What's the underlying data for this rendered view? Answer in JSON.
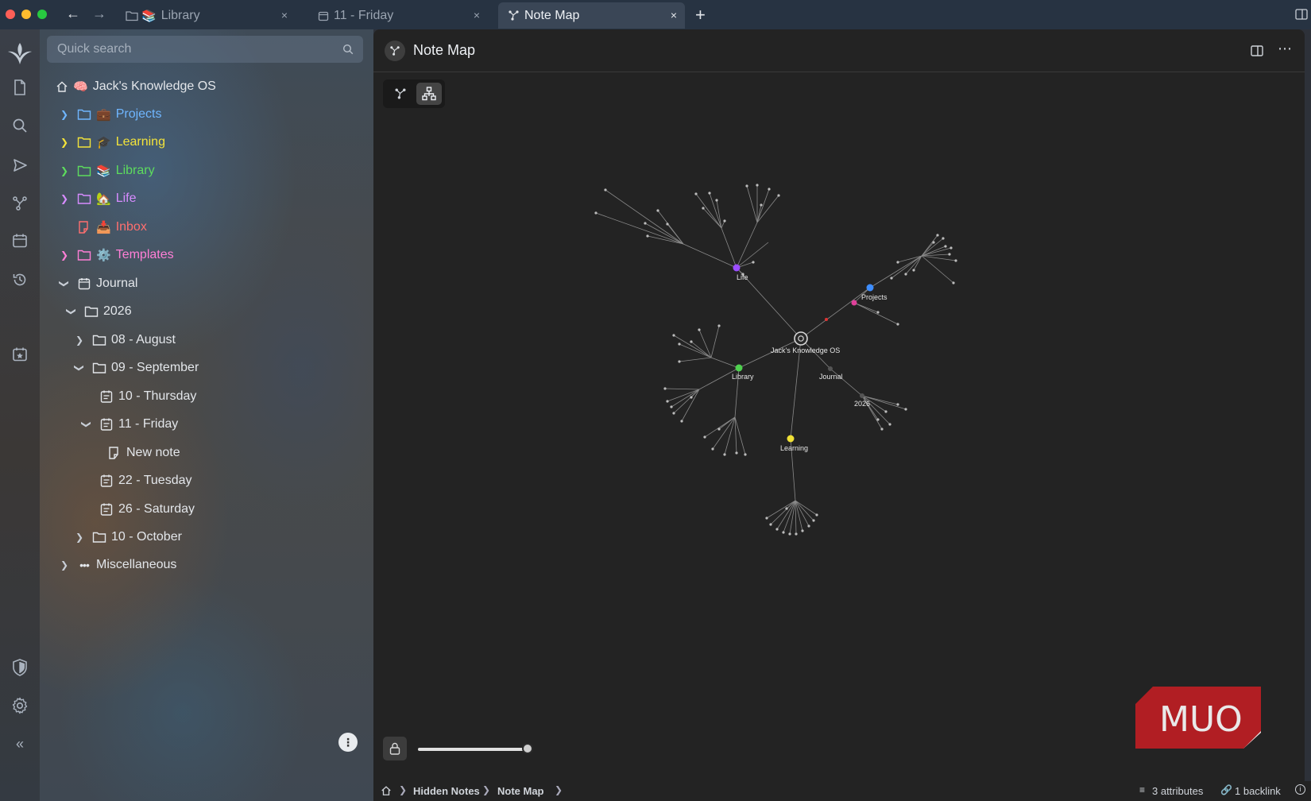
{
  "window": {
    "tabs": [
      {
        "label": "Library",
        "emoji": "📚",
        "icon": "folder-icon"
      },
      {
        "label": "11 - Friday",
        "icon": "calendar-note-icon"
      },
      {
        "label": "Note Map",
        "icon": "note-map-icon",
        "active": true
      }
    ],
    "new_tab": "+",
    "close": "×"
  },
  "search": {
    "placeholder": "Quick search"
  },
  "tree": {
    "root": {
      "label": "Jack's Knowledge OS",
      "emoji": "🧠"
    },
    "items": [
      {
        "label": "Projects",
        "emoji": "💼",
        "color": "#6fb6ff"
      },
      {
        "label": "Learning",
        "emoji": "🎓",
        "color": "#f3e33a"
      },
      {
        "label": "Library",
        "emoji": "📚",
        "color": "#5ddc5d"
      },
      {
        "label": "Life",
        "emoji": "🏡",
        "color": "#d78cff"
      },
      {
        "label": "Inbox",
        "emoji": "📥",
        "color": "#ff6f6f"
      },
      {
        "label": "Templates",
        "emoji": "⚙️",
        "color": "#ff7fd6"
      },
      {
        "label": "Journal",
        "color": "#e3e6ea"
      },
      {
        "label": "2026",
        "color": "#e3e6ea"
      },
      {
        "label": "08 - August",
        "color": "#e3e6ea"
      },
      {
        "label": "09 - September",
        "color": "#e3e6ea"
      },
      {
        "label": "10 - Thursday",
        "color": "#e3e6ea"
      },
      {
        "label": "11 - Friday",
        "color": "#e3e6ea"
      },
      {
        "label": "New note",
        "color": "#e3e6ea"
      },
      {
        "label": "22 - Tuesday",
        "color": "#e3e6ea"
      },
      {
        "label": "26 - Saturday",
        "color": "#e3e6ea"
      },
      {
        "label": "10 - October",
        "color": "#e3e6ea"
      },
      {
        "label": "Miscellaneous",
        "color": "#e3e6ea"
      }
    ]
  },
  "note": {
    "title": "Note Map"
  },
  "map": {
    "zoom_slider_value": 1.0,
    "labels": {
      "root": "Jack's Knowledge OS",
      "life": "Life",
      "projects": "Projects",
      "library": "Library",
      "journal": "Journal",
      "year": "2026",
      "learning": "Learning"
    },
    "colors": {
      "life": "#9b4dff",
      "projects": "#3d8dff",
      "projects_alt": "#e0409a",
      "library": "#4fd14f",
      "learning": "#f0e136"
    }
  },
  "statusbar": {
    "crumbs": [
      "Hidden Notes",
      "Note Map"
    ],
    "attributes": "3 attributes",
    "backlinks": "1 backlink"
  },
  "watermark": {
    "text": "MUO"
  }
}
